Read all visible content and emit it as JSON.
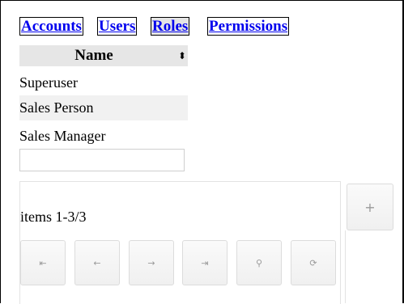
{
  "tabs": [
    {
      "label": "Accounts",
      "active": false
    },
    {
      "label": "Users",
      "active": false
    },
    {
      "label": "Roles",
      "active": true
    },
    {
      "label": "Permissions",
      "active": false
    }
  ],
  "grid": {
    "column_header": "Name",
    "sort_icon": "sort-icon",
    "rows": [
      "Superuser",
      "Sales Person",
      "Sales Manager"
    ]
  },
  "new_role_input": {
    "value": "",
    "placeholder": ""
  },
  "pager": {
    "items_text": "items 1-3/3",
    "buttons": [
      {
        "name": "first-page-icon",
        "glyph": "⇤"
      },
      {
        "name": "previous-page-icon",
        "glyph": "←"
      },
      {
        "name": "next-page-icon",
        "glyph": "→"
      },
      {
        "name": "last-page-icon",
        "glyph": "⇥"
      },
      {
        "name": "search-icon",
        "glyph": "⚲"
      },
      {
        "name": "refresh-icon",
        "glyph": "⟳"
      }
    ]
  },
  "add_button": {
    "glyph": "+",
    "icon": "plus-icon"
  },
  "colors": {
    "link": "#0000ee",
    "active_tab_bg": "#e5e5e5",
    "header_bg": "#e6e6e6",
    "alt_row_bg": "#f1f1f1",
    "icon": "#9a9a9a"
  }
}
